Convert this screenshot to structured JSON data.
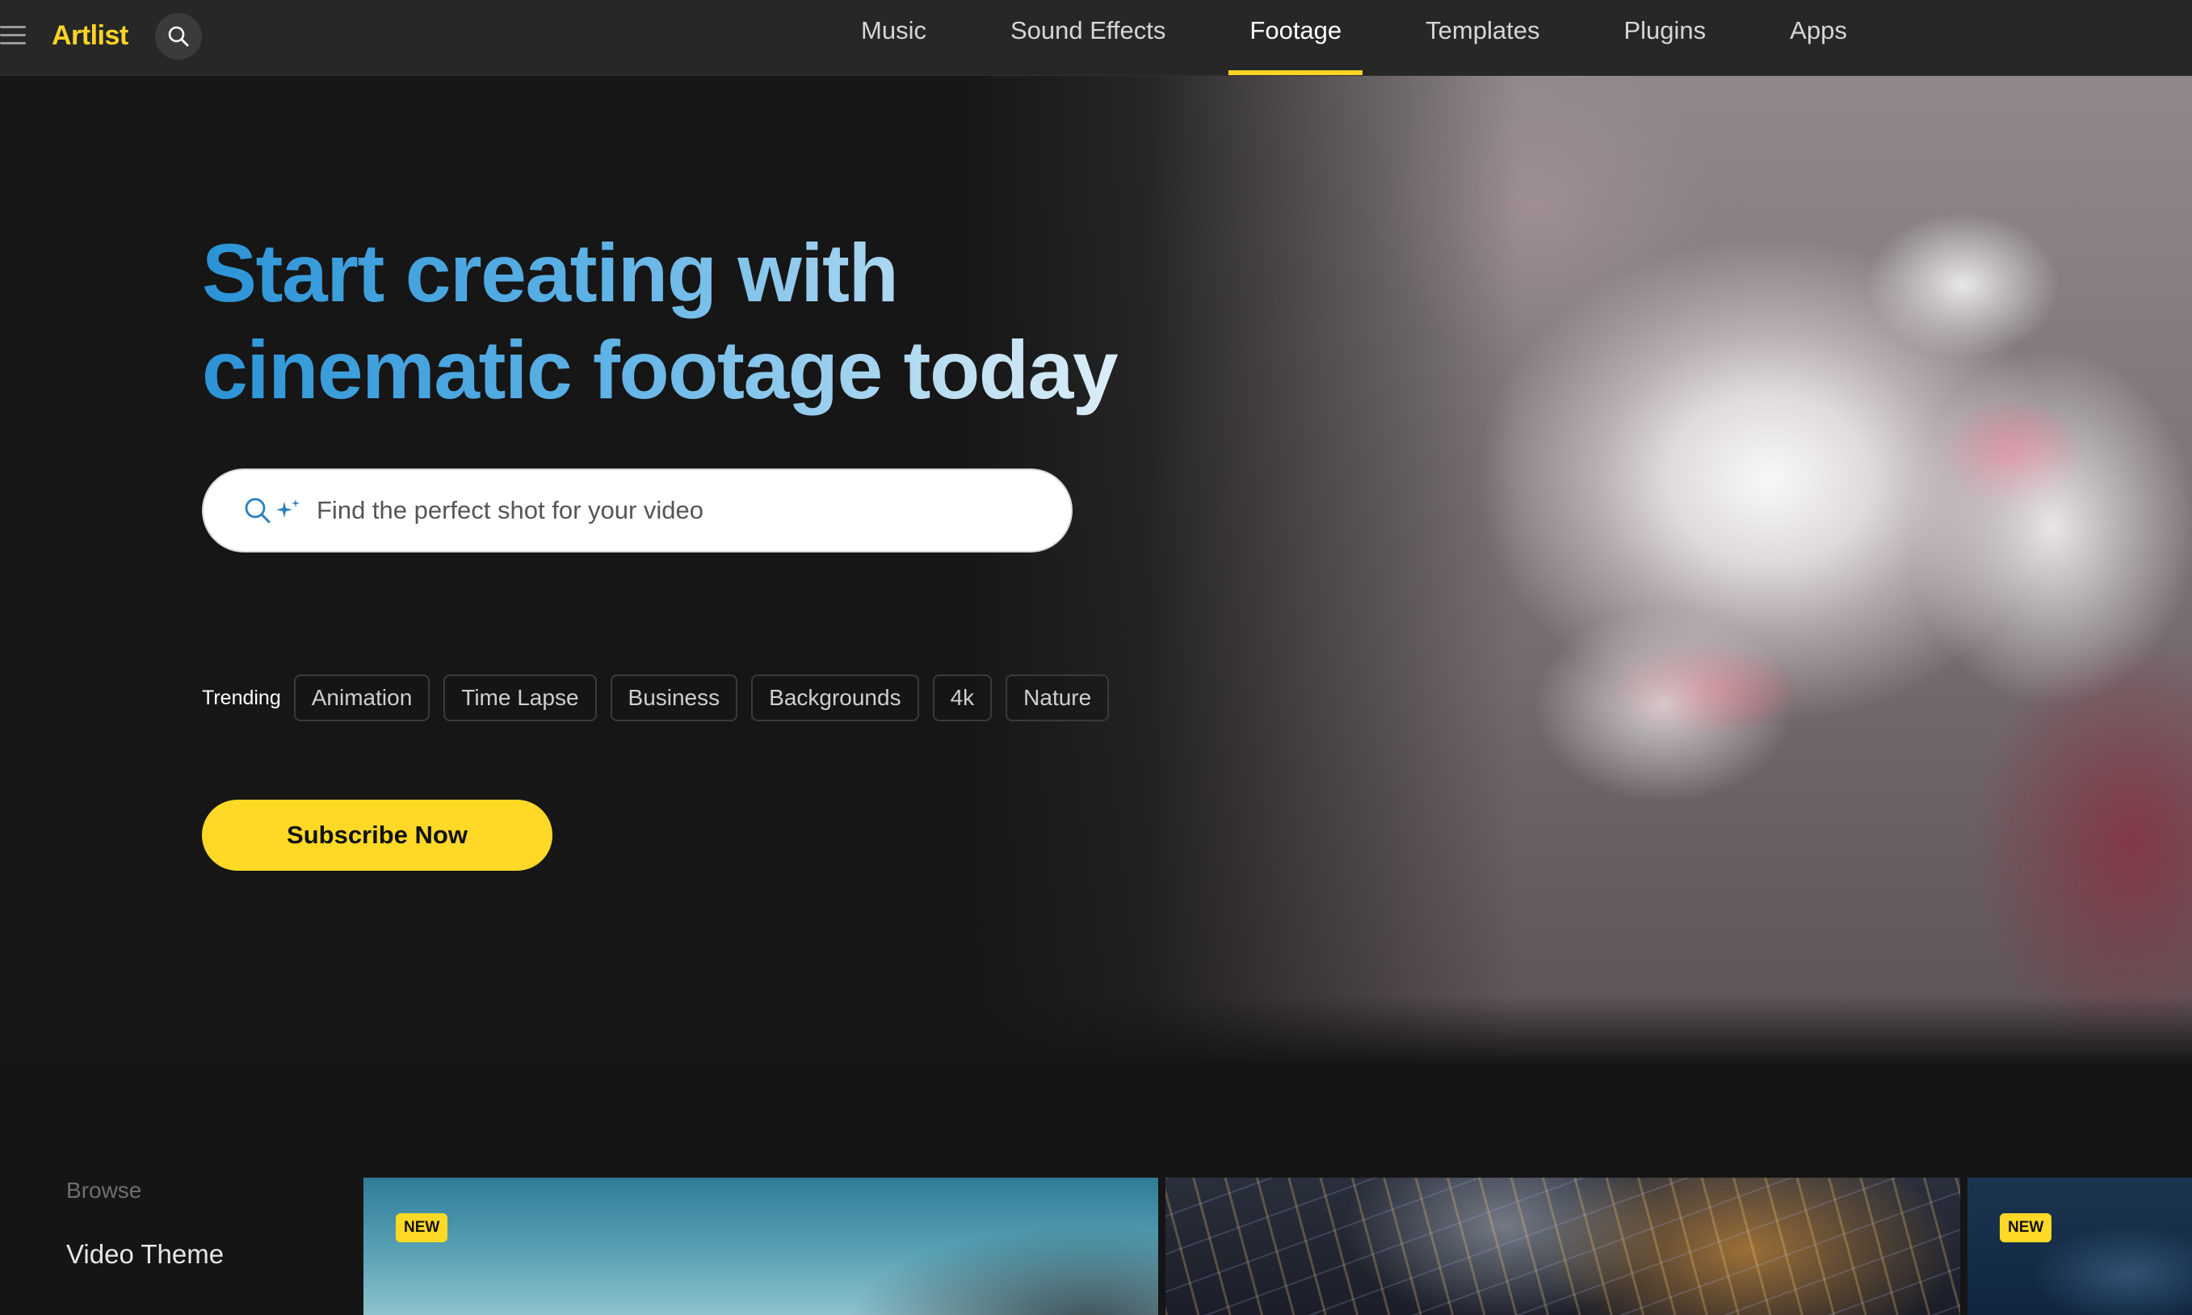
{
  "brand": {
    "logo_text": "Artlist",
    "accent_color": "#ffd426",
    "headline_gradient": [
      "#2b93d6",
      "#eef6fb"
    ]
  },
  "header": {
    "menu_icon": "hamburger-icon",
    "search_icon": "search-icon",
    "tabs": [
      {
        "label": "Music",
        "active": false
      },
      {
        "label": "Sound Effects",
        "active": false
      },
      {
        "label": "Footage",
        "active": true
      },
      {
        "label": "Templates",
        "active": false
      },
      {
        "label": "Plugins",
        "active": false
      },
      {
        "label": "Apps",
        "active": false
      }
    ]
  },
  "hero": {
    "headline": "Start creating with cinematic footage today",
    "search": {
      "placeholder": "Find the perfect shot for your video",
      "value": "",
      "icons": [
        "search-icon",
        "sparkle-icon"
      ]
    },
    "trending": {
      "label": "Trending",
      "chips": [
        "Animation",
        "Time Lapse",
        "Business",
        "Backgrounds",
        "4k",
        "Nature"
      ]
    },
    "cta_label": "Subscribe Now",
    "background_image": "cherry-blossom-photo"
  },
  "browse": {
    "title": "Browse",
    "first_item": "Video Theme",
    "thumbnails": [
      {
        "badge": "NEW",
        "image": "mountain-lake-footage"
      },
      {
        "badge": "",
        "image": "city-night-aerial-footage"
      },
      {
        "badge": "NEW",
        "image": "ocean-water-footage"
      }
    ]
  }
}
